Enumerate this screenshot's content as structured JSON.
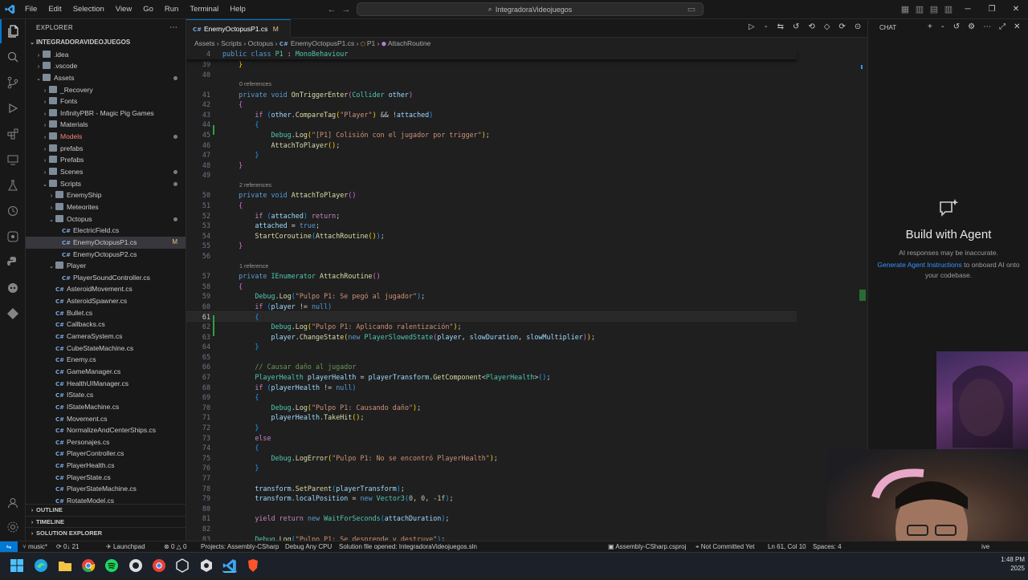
{
  "menu": [
    "File",
    "Edit",
    "Selection",
    "View",
    "Go",
    "Run",
    "Terminal",
    "Help"
  ],
  "search_label": "IntegradoraVideojuegos",
  "explorer": {
    "title": "EXPLORER",
    "root": "INTEGRADORAVIDEOJUEGOS",
    "items": [
      {
        "label": ".idea",
        "indent": 1,
        "kind": "folder-closed"
      },
      {
        "label": ".vscode",
        "indent": 1,
        "kind": "folder-closed"
      },
      {
        "label": "Assets",
        "indent": 1,
        "kind": "folder-open",
        "dot": true
      },
      {
        "label": "_Recovery",
        "indent": 2,
        "kind": "folder-closed"
      },
      {
        "label": "Fonts",
        "indent": 2,
        "kind": "folder-closed"
      },
      {
        "label": "InfinityPBR - Magic Pig Games",
        "indent": 2,
        "kind": "folder-closed"
      },
      {
        "label": "Materials",
        "indent": 2,
        "kind": "folder-closed"
      },
      {
        "label": "Models",
        "indent": 2,
        "kind": "folder-closed",
        "red": true,
        "dot": true
      },
      {
        "label": "prefabs",
        "indent": 2,
        "kind": "folder-closed"
      },
      {
        "label": "Prefabs",
        "indent": 2,
        "kind": "folder-closed"
      },
      {
        "label": "Scenes",
        "indent": 2,
        "kind": "folder-closed",
        "dot": true
      },
      {
        "label": "Scripts",
        "indent": 2,
        "kind": "folder-open",
        "dot": true
      },
      {
        "label": "EnemyShip",
        "indent": 3,
        "kind": "folder-closed"
      },
      {
        "label": "Meteorites",
        "indent": 3,
        "kind": "folder-closed"
      },
      {
        "label": "Octopus",
        "indent": 3,
        "kind": "folder-open",
        "dot": true
      },
      {
        "label": "ElectricField.cs",
        "indent": 4,
        "kind": "cs"
      },
      {
        "label": "EnemyOctopusP1.cs",
        "indent": 4,
        "kind": "cs",
        "selected": true,
        "mod": "M"
      },
      {
        "label": "EnemyOctopusP2.cs",
        "indent": 4,
        "kind": "cs"
      },
      {
        "label": "Player",
        "indent": 3,
        "kind": "folder-open"
      },
      {
        "label": "PlayerSoundController.cs",
        "indent": 4,
        "kind": "cs"
      },
      {
        "label": "AsteroidMovement.cs",
        "indent": 3,
        "kind": "cs"
      },
      {
        "label": "AsteroidSpawner.cs",
        "indent": 3,
        "kind": "cs"
      },
      {
        "label": "Bullet.cs",
        "indent": 3,
        "kind": "cs"
      },
      {
        "label": "Callbacks.cs",
        "indent": 3,
        "kind": "cs"
      },
      {
        "label": "CameraSystem.cs",
        "indent": 3,
        "kind": "cs"
      },
      {
        "label": "CubeStateMachine.cs",
        "indent": 3,
        "kind": "cs"
      },
      {
        "label": "Enemy.cs",
        "indent": 3,
        "kind": "cs"
      },
      {
        "label": "GameManager.cs",
        "indent": 3,
        "kind": "cs"
      },
      {
        "label": "HealthUIManager.cs",
        "indent": 3,
        "kind": "cs"
      },
      {
        "label": "IState.cs",
        "indent": 3,
        "kind": "cs"
      },
      {
        "label": "IStateMachine.cs",
        "indent": 3,
        "kind": "cs"
      },
      {
        "label": "Movement.cs",
        "indent": 3,
        "kind": "cs"
      },
      {
        "label": "NormalizeAndCenterShips.cs",
        "indent": 3,
        "kind": "cs"
      },
      {
        "label": "Personajes.cs",
        "indent": 3,
        "kind": "cs"
      },
      {
        "label": "PlayerController.cs",
        "indent": 3,
        "kind": "cs"
      },
      {
        "label": "PlayerHealth.cs",
        "indent": 3,
        "kind": "cs"
      },
      {
        "label": "PlayerState.cs",
        "indent": 3,
        "kind": "cs"
      },
      {
        "label": "PlayerStateMachine.cs",
        "indent": 3,
        "kind": "cs"
      },
      {
        "label": "RotateModel.cs",
        "indent": 3,
        "kind": "cs"
      }
    ],
    "sections": [
      "OUTLINE",
      "TIMELINE",
      "SOLUTION EXPLORER"
    ]
  },
  "tab": {
    "label": "EnemyOctopusP1.cs",
    "mod": "M"
  },
  "breadcrumb": [
    "Assets",
    "Scripts",
    "Octopus",
    "EnemyOctopusP1.cs",
    "P1",
    "AttachRoutine"
  ],
  "sticky_line": {
    "num": "4",
    "html": "<span class=\"k\">public</span> <span class=\"k\">class</span> <span class=\"t\">P1</span> : <span class=\"t\">MonoBehaviour</span>"
  },
  "code_lines": [
    {
      "num": "39",
      "html": "    <span class=\"b1\">}</span>"
    },
    {
      "num": "40",
      "html": ""
    },
    {
      "lens": "0 references"
    },
    {
      "num": "41",
      "html": "    <span class=\"k\">private</span> <span class=\"k\">void</span> <span class=\"f\">OnTriggerEnter</span><span class=\"b2\">(</span><span class=\"t\">Collider</span> <span class=\"v\">other</span><span class=\"b2\">)</span>"
    },
    {
      "num": "42",
      "html": "    <span class=\"b2\">{</span>"
    },
    {
      "num": "43",
      "html": "        <span class=\"kc\">if</span> <span class=\"b3\">(</span><span class=\"v\">other</span>.<span class=\"f\">CompareTag</span><span class=\"b1\">(</span><span class=\"s\">\"Player\"</span><span class=\"b1\">)</span> &amp;&amp; !<span class=\"v\">attached</span><span class=\"b3\">)</span>"
    },
    {
      "num": "44",
      "html": "        <span class=\"b3\">{</span>"
    },
    {
      "num": "45",
      "html": "            <span class=\"t\">Debug</span>.<span class=\"f\">Log</span><span class=\"b1\">(</span><span class=\"s\">\"[P1] Colisión con el jugador por trigger\"</span><span class=\"b1\">)</span>;"
    },
    {
      "num": "46",
      "html": "            <span class=\"f\">AttachToPlayer</span><span class=\"b1\">()</span>;"
    },
    {
      "num": "47",
      "html": "        <span class=\"b3\">}</span>"
    },
    {
      "num": "48",
      "html": "    <span class=\"b2\">}</span>"
    },
    {
      "num": "49",
      "html": ""
    },
    {
      "lens": "2 references"
    },
    {
      "num": "50",
      "html": "    <span class=\"k\">private</span> <span class=\"k\">void</span> <span class=\"f\">AttachToPlayer</span><span class=\"b2\">()</span>"
    },
    {
      "num": "51",
      "html": "    <span class=\"b2\">{</span>"
    },
    {
      "num": "52",
      "html": "        <span class=\"kc\">if</span> <span class=\"b3\">(</span><span class=\"v\">attached</span><span class=\"b3\">)</span> <span class=\"kc\">return</span>;"
    },
    {
      "num": "53",
      "html": "        <span class=\"v\">attached</span> = <span class=\"k\">true</span>;"
    },
    {
      "num": "54",
      "html": "        <span class=\"f\">StartCoroutine</span><span class=\"b3\">(</span><span class=\"f\">AttachRoutine</span><span class=\"b1\">()</span><span class=\"b3\">)</span>;"
    },
    {
      "num": "55",
      "html": "    <span class=\"b2\">}</span>"
    },
    {
      "num": "56",
      "html": ""
    },
    {
      "lens": "1 reference"
    },
    {
      "num": "57",
      "html": "    <span class=\"k\">private</span> <span class=\"t\">IEnumerator</span> <span class=\"f\">AttachRoutine</span><span class=\"b2\">()</span>"
    },
    {
      "num": "58",
      "html": "    <span class=\"b2\">{</span>"
    },
    {
      "num": "59",
      "html": "        <span class=\"t\">Debug</span>.<span class=\"f\">Log</span><span class=\"b3\">(</span><span class=\"s\">\"Pulpo P1: Se pegó al jugador\"</span><span class=\"b3\">)</span>;"
    },
    {
      "num": "60",
      "html": "        <span class=\"kc\">if</span> <span class=\"b3\">(</span><span class=\"v\">player</span> != <span class=\"k\">null</span><span class=\"b3\">)</span>"
    },
    {
      "num": "61",
      "html": "        <span class=\"b3\">{</span>",
      "current": true
    },
    {
      "num": "62",
      "html": "            <span class=\"t\">Debug</span>.<span class=\"f\">Log</span><span class=\"b1\">(</span><span class=\"s\">\"Pulpo P1: Aplicando ralentización\"</span><span class=\"b1\">)</span>;"
    },
    {
      "num": "63",
      "html": "            <span class=\"v\">player</span>.<span class=\"f\">ChangeState</span><span class=\"b1\">(</span><span class=\"k\">new</span> <span class=\"t\">PlayerSlowedState</span><span class=\"b2\">(</span><span class=\"v\">player</span>, <span class=\"v\">slowDuration</span>, <span class=\"v\">slowMultiplier</span><span class=\"b2\">)</span><span class=\"b1\">)</span>;"
    },
    {
      "num": "64",
      "html": "        <span class=\"b3\">}</span>"
    },
    {
      "num": "65",
      "html": ""
    },
    {
      "num": "66",
      "html": "        <span class=\"c\">// Causar daño al jugador</span>"
    },
    {
      "num": "67",
      "html": "        <span class=\"t\">PlayerHealth</span> <span class=\"v\">playerHealth</span> = <span class=\"v\">playerTransform</span>.<span class=\"f\">GetComponent</span>&lt;<span class=\"t\">PlayerHealth</span>&gt;<span class=\"b3\">()</span>;"
    },
    {
      "num": "68",
      "html": "        <span class=\"kc\">if</span> <span class=\"b3\">(</span><span class=\"v\">playerHealth</span> != <span class=\"k\">null</span><span class=\"b3\">)</span>"
    },
    {
      "num": "69",
      "html": "        <span class=\"b3\">{</span>"
    },
    {
      "num": "70",
      "html": "            <span class=\"t\">Debug</span>.<span class=\"f\">Log</span><span class=\"b1\">(</span><span class=\"s\">\"Pulpo P1: Causando daño\"</span><span class=\"b1\">)</span>;"
    },
    {
      "num": "71",
      "html": "            <span class=\"v\">playerHealth</span>.<span class=\"f\">TakeHit</span><span class=\"b1\">()</span>;"
    },
    {
      "num": "72",
      "html": "        <span class=\"b3\">}</span>"
    },
    {
      "num": "73",
      "html": "        <span class=\"kc\">else</span>"
    },
    {
      "num": "74",
      "html": "        <span class=\"b3\">{</span>"
    },
    {
      "num": "75",
      "html": "            <span class=\"t\">Debug</span>.<span class=\"f\">LogError</span><span class=\"b1\">(</span><span class=\"s\">\"Pulpo P1: No se encontró PlayerHealth\"</span><span class=\"b1\">)</span>;"
    },
    {
      "num": "76",
      "html": "        <span class=\"b3\">}</span>"
    },
    {
      "num": "77",
      "html": ""
    },
    {
      "num": "78",
      "html": "        <span class=\"v\">transform</span>.<span class=\"f\">SetParent</span><span class=\"b3\">(</span><span class=\"v\">playerTransform</span><span class=\"b3\">)</span>;"
    },
    {
      "num": "79",
      "html": "        <span class=\"v\">transform</span>.<span class=\"v\">localPosition</span> = <span class=\"k\">new</span> <span class=\"t\">Vector3</span><span class=\"b3\">(</span><span class=\"n\">0</span>, <span class=\"n\">0</span>, <span class=\"n\">-1f</span><span class=\"b3\">)</span>;"
    },
    {
      "num": "80",
      "html": ""
    },
    {
      "num": "81",
      "html": "        <span class=\"kc\">yield</span> <span class=\"kc\">return</span> <span class=\"k\">new</span> <span class=\"t\">WaitForSeconds</span><span class=\"b3\">(</span><span class=\"v\">attachDuration</span><span class=\"b3\">)</span>;"
    },
    {
      "num": "82",
      "html": ""
    },
    {
      "num": "83",
      "html": "        <span class=\"t\">Debug</span>.<span class=\"f\">Log</span><span class=\"b3\">(</span><span class=\"s\">\"Pulpo P1: Se desprende y destruye\"</span><span class=\"b3\">)</span>;"
    }
  ],
  "chat": {
    "title": "CHAT",
    "heading": "Build with Agent",
    "sub1": "AI responses may be inaccurate.",
    "link": "Generate Agent Instructions",
    "sub2": " to onboard AI onto your codebase."
  },
  "status": {
    "branch": "music*",
    "sync": "0↓ 21",
    "launchpad": "Launchpad",
    "errors": "0",
    "warnings": "0",
    "projects": "Projects: Assembly-CSharp",
    "debug": "Debug Any CPU",
    "solution": "Solution file opened: IntegradoraVideojuegos.sln",
    "csproj": "Assembly-CSharp.csproj",
    "committed": "Not Committed Yet",
    "position": "Ln 61, Col 10",
    "spaces": "Spaces: 4",
    "ive": "ive"
  },
  "clock": {
    "time": "1:48 PM",
    "date": "2025"
  }
}
